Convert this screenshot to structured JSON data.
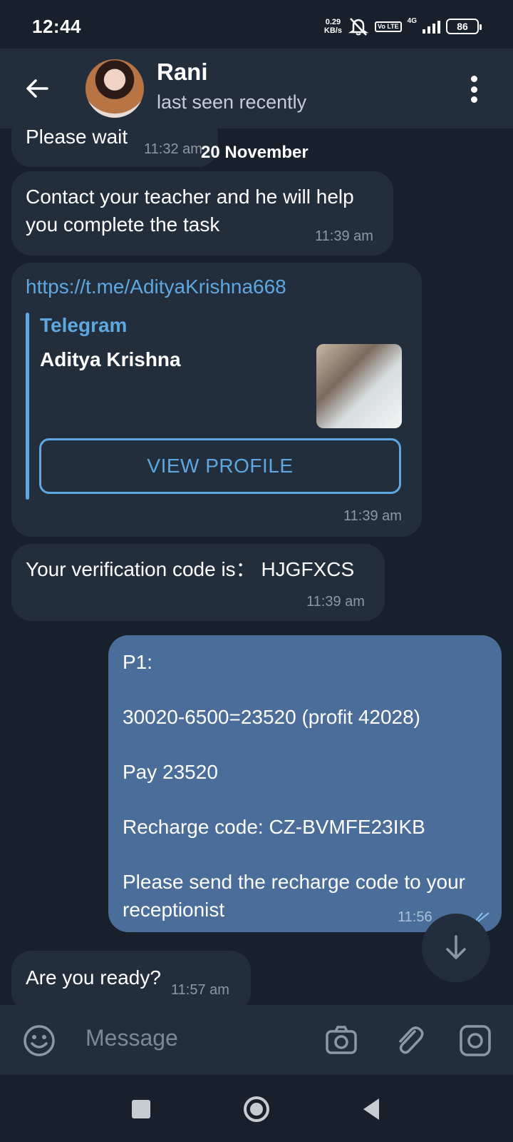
{
  "status_bar": {
    "time": "12:44",
    "speed_value": "0.29",
    "speed_unit": "KB/s",
    "volte": "Vo LTE",
    "network": "4G",
    "battery": "86"
  },
  "header": {
    "name": "Rani",
    "status": "last seen recently"
  },
  "date_chip": "20 November",
  "messages": [
    {
      "direction": "in",
      "text": "Please wait",
      "time": "11:32 am"
    },
    {
      "direction": "in",
      "text": "Contact your teacher and he will help you complete the task",
      "time": "11:39 am"
    },
    {
      "direction": "in",
      "link": "https://t.me/AdityaKrishna668",
      "preview_site": "Telegram",
      "preview_title": "Aditya Krishna",
      "button": "VIEW PROFILE",
      "time": "11:39 am"
    },
    {
      "direction": "in",
      "text": "Your verification code is： HJGFXCS",
      "time": "11:39 am"
    },
    {
      "direction": "out",
      "lines": [
        "P1:",
        "30020-6500=23520 (profit 42028)",
        "Pay 23520",
        "Recharge code: CZ-BVMFE23IKB",
        "Please send the recharge code to your receptionist"
      ],
      "time": "11:56"
    },
    {
      "direction": "in",
      "text": "Are you ready?",
      "time": "11:57 am"
    }
  ],
  "input": {
    "placeholder": "Message"
  },
  "colors": {
    "background": "#18202b",
    "header": "#232e3c",
    "incoming_bubble": "#222e3b",
    "outgoing_bubble": "#4a6e99",
    "accent": "#5ea7e0"
  }
}
